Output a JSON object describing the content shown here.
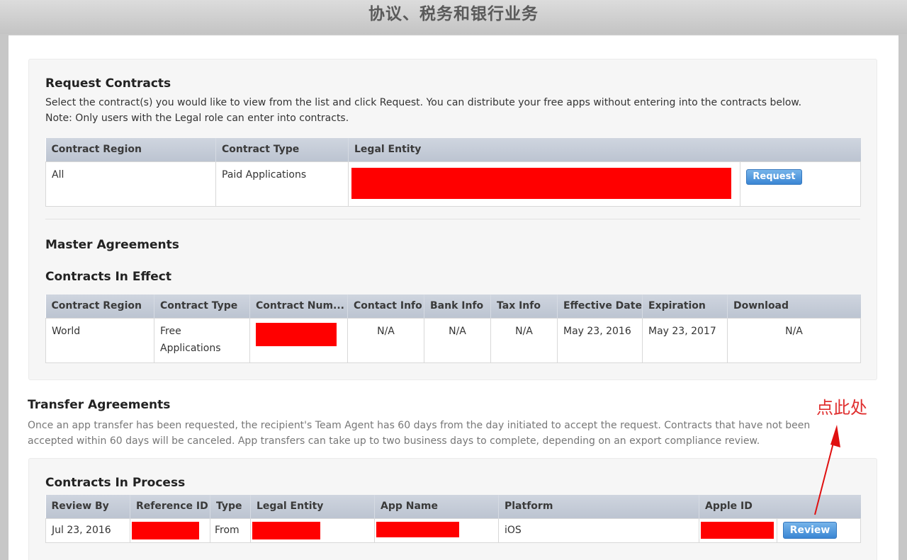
{
  "header": {
    "title": "协议、税务和银行业务"
  },
  "request_contracts": {
    "title": "Request Contracts",
    "desc_line1": "Select the contract(s) you would like to view from the list and click Request. You can distribute your free apps without entering into the contracts below.",
    "desc_line2": "Note: Only users with the Legal role can enter into contracts.",
    "columns": [
      "Contract Region",
      "Contract Type",
      "Legal Entity"
    ],
    "row": {
      "region": "All",
      "type": "Paid Applications"
    },
    "request_button": "Request"
  },
  "master_agreements": {
    "title": "Master Agreements"
  },
  "contracts_in_effect": {
    "title": "Contracts In Effect",
    "columns": [
      "Contract Region",
      "Contract Type",
      "Contract Num...",
      "Contact Info",
      "Bank Info",
      "Tax Info",
      "Effective Date",
      "Expiration",
      "Download"
    ],
    "row": {
      "region": "World",
      "type_line1": "Free",
      "type_line2": "Applications",
      "contact": "N/A",
      "bank": "N/A",
      "tax": "N/A",
      "effective": "May 23, 2016",
      "expiration": "May 23, 2017",
      "download": "N/A"
    }
  },
  "transfer_agreements": {
    "title": "Transfer Agreements",
    "desc_line1": "Once an app transfer has been requested, the recipient's Team Agent has 60 days from the day initiated to accept the request. Contracts that have not been",
    "desc_line2": "accepted within 60 days will be canceled. App transfers can take up to two business days to complete, depending on an export compliance review."
  },
  "contracts_in_process": {
    "title": "Contracts In Process",
    "columns": [
      "Review By",
      "Reference ID",
      "Type",
      "Legal Entity",
      "App Name",
      "Platform",
      "Apple ID"
    ],
    "row": {
      "review_by": "Jul 23, 2016",
      "type": "From",
      "platform": "iOS"
    },
    "review_button": "Review"
  },
  "annotation": {
    "text": "点此处",
    "color": "#e03030"
  },
  "colors": {
    "redaction": "#ff0000",
    "button": "#3a86d4"
  }
}
